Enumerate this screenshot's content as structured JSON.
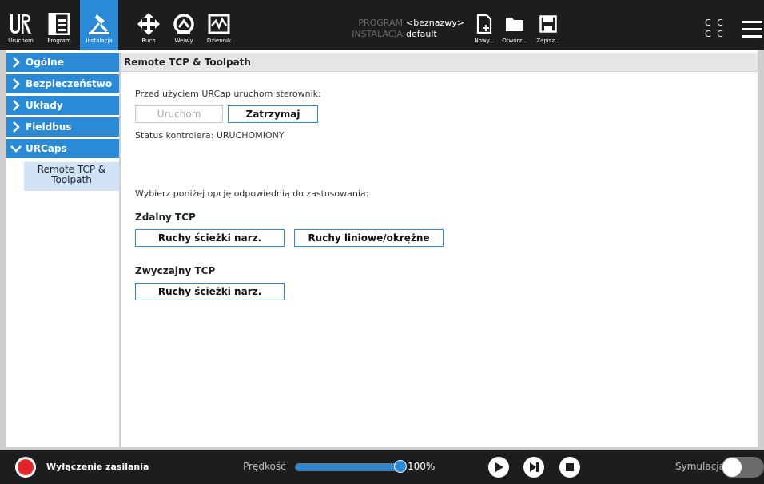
{
  "topbar": {
    "tabs": [
      {
        "label": "Uruchom",
        "icon": "ur-logo-icon"
      },
      {
        "label": "Program",
        "icon": "program-icon"
      },
      {
        "label": "Instalacja",
        "icon": "installation-icon",
        "active": true
      },
      {
        "label": "Ruch",
        "icon": "move-icon"
      },
      {
        "label": "We/wy",
        "icon": "io-icon"
      },
      {
        "label": "Dziennik",
        "icon": "log-icon"
      }
    ],
    "program_key": "PROGRAM",
    "program_value": "<beznazwy>",
    "installation_key": "INSTALACJA",
    "installation_value": "default",
    "file_buttons": [
      {
        "label": "Nowy...",
        "icon": "new-file-icon"
      },
      {
        "label": "Otwórz...",
        "icon": "folder-icon"
      },
      {
        "label": "Zapisz...",
        "icon": "save-icon"
      }
    ],
    "status_row1": "C C",
    "status_row2": "C C",
    "menu_icon": "hamburger-menu-icon"
  },
  "sidebar": {
    "items": [
      {
        "label": "Ogólne",
        "expanded": false
      },
      {
        "label": "Bezpieczeństwo",
        "expanded": false
      },
      {
        "label": "Układy",
        "expanded": false
      },
      {
        "label": "Fieldbus",
        "expanded": false
      },
      {
        "label": "URCaps",
        "expanded": true
      }
    ],
    "subitem": "Remote TCP & Toolpath"
  },
  "main": {
    "title": "Remote TCP & Toolpath",
    "intro": "Przed użyciem URCap uruchom sterownik:",
    "start_button": "Uruchom",
    "stop_button": "Zatrzymaj",
    "status": "Status kontrolera: URUCHOMIONY",
    "choose_text": "Wybierz poniżej opcję odpowiednią do zastosowania:",
    "remote_heading": "Zdalny TCP",
    "remote_toolpath_button": "Ruchy ścieżki narz.",
    "remote_linear_button": "Ruchy liniowe/okrężne",
    "regular_heading": "Zwyczajny TCP",
    "regular_toolpath_button": "Ruchy ścieżki narz."
  },
  "bottombar": {
    "power_label": "Wyłączenie zasilania",
    "speed_label": "Prędkość",
    "speed_value": "100%",
    "speed_fraction": 1.0,
    "simulation_label": "Symulacja",
    "simulation_on": false,
    "colors": {
      "power": "#e3262d",
      "accent": "#2b8ad6"
    }
  }
}
